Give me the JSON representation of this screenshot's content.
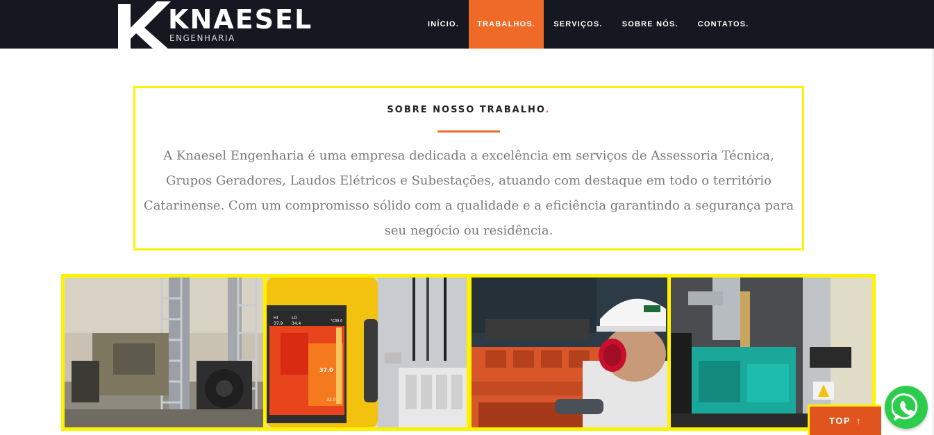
{
  "header": {
    "logo_text": "KNAESEL",
    "logo_subtitle": "ENGENHARIA",
    "nav": [
      {
        "label": "INÍCIO.",
        "active": false
      },
      {
        "label": "TRABALHOS.",
        "active": true
      },
      {
        "label": "SERVIÇOS.",
        "active": false
      },
      {
        "label": "SOBRE NÓS.",
        "active": false
      },
      {
        "label": "CONTATOS.",
        "active": false
      }
    ]
  },
  "about": {
    "title": "SOBRE NOSSO TRABALHO",
    "title_dot": ".",
    "text": "A Knaesel Engenharia é uma empresa dedicada a excelência em serviços de Assessoria Técnica, Grupos Geradores, Laudos Elétricos e Subestações, atuando com destaque em todo o território Catarinense. Com um compromisso sólido com a qualidade e a eficiência garantindo a segurança para seu negócio ou residência."
  },
  "gallery": {
    "thermal_readings": {
      "hi": "HI",
      "lo": "LO",
      "hi_val": "37.9",
      "lo_val": "34.4",
      "center": "37.0",
      "scale_top": "39.0",
      "scale_bottom": "33.0",
      "unit": "°C"
    }
  },
  "top_button": {
    "label": "TOP",
    "arrow": "↑"
  },
  "colors": {
    "accent": "#ef6a26",
    "highlight": "#fff200",
    "navbar": "#151821",
    "whatsapp": "#2ccd4d"
  }
}
